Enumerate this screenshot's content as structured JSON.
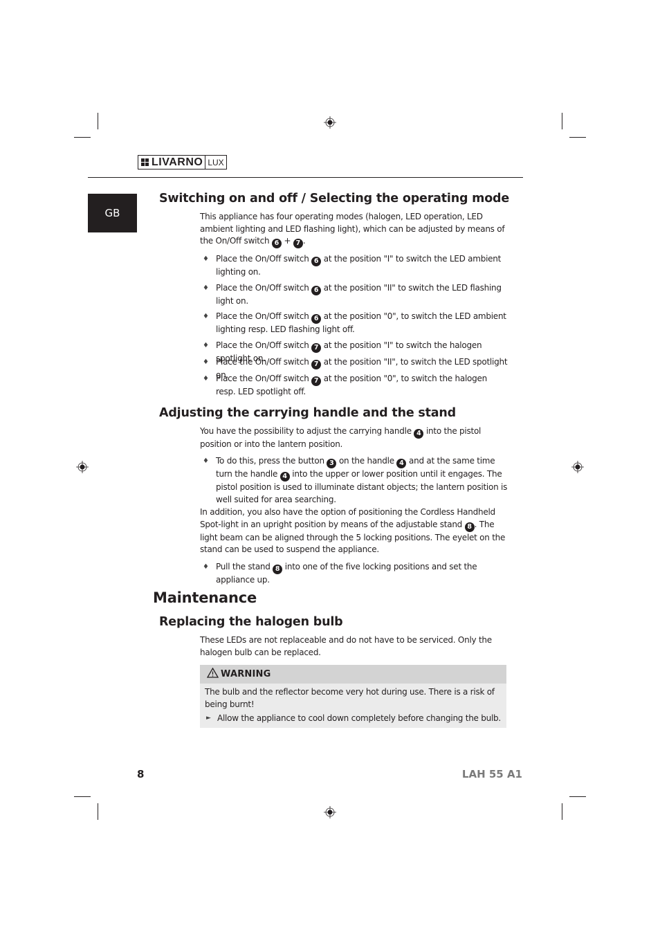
{
  "header": {
    "brand": "LIVARNO",
    "brand_suffix": "LUX",
    "language_tab": "GB"
  },
  "section_switching": {
    "title": "Switching on and off / Selecting the operating mode",
    "intro": [
      " This appliance has four operating modes (halogen, LED operation, LED ambient lighting and LED flashing light), which can be adjusted by means of the On/Off switch ",
      "6",
      " + ",
      "7",
      "."
    ],
    "bullets": [
      {
        "pre": "Place the On/Off switch ",
        "num": "6",
        "post": " at the position \"I\" to switch the LED ambient lighting on."
      },
      {
        "pre": "Place the On/Off switch ",
        "num": "6",
        "post": " at the position \"II\" to switch the LED flashing light on."
      },
      {
        "pre": "Place the On/Off switch ",
        "num": "6",
        "post": " at the position \"0\", to switch the LED ambient lighting resp. LED flashing light off."
      },
      {
        "pre": "Place the On/Off switch ",
        "num": "7",
        "post": " at the position \"I\" to switch the halogen spotlight on."
      },
      {
        "pre": "Place the On/Off switch ",
        "num": "7",
        "post": " at the position \"II\", to switch the LED spotlight on."
      },
      {
        "pre": "Place the On/Off switch ",
        "num": "7",
        "post": " at the position \"0\", to switch the halogen resp. LED spotlight off."
      }
    ]
  },
  "section_handle": {
    "title": "Adjusting the carrying handle and the stand",
    "intro": {
      "pre": "You have the possibility to adjust the carrying handle ",
      "num": "4",
      "post": " into the pistol position or into the lantern position."
    },
    "bullet1": {
      "a": "To do this, press the button ",
      "n1": "3",
      "b": " on the handle ",
      "n2": "4",
      "c": " and at the same time turn the handle ",
      "n3": "4",
      "d": " into the upper or lower position until it engages. The pistol position is used to illuminate distant objects; the lantern position is well suited for area searching."
    },
    "para2": {
      "pre": "In addition, you also have the option of positioning the Cordless Handheld Spot-light in an upright position by means of the adjustable stand ",
      "num": "8",
      "post": ". The light beam can be aligned through the 5 locking positions. The eyelet on the stand can be used to suspend the appliance."
    },
    "bullet2": {
      "pre": "Pull the stand ",
      "num": "8",
      "post": " into one of the five locking positions and set the appliance up."
    }
  },
  "section_maintenance": {
    "title": "Maintenance",
    "subtitle": "Replacing the halogen bulb",
    "intro": "These LEDs are not replaceable and do not have to be serviced. Only the halogen bulb can be replaced.",
    "warning": {
      "icon": "warning-triangle-icon",
      "label": "WARNING",
      "text": "The bulb and the reflector become very hot during use. There is a risk of being burnt!",
      "step": "Allow the appliance to cool down completely before changing the bulb."
    }
  },
  "footer": {
    "page_number": "8",
    "model": "LAH 55 A1"
  },
  "glyphs": {
    "diamond": "♦",
    "arrow": "►",
    "triangle": "⚠"
  }
}
